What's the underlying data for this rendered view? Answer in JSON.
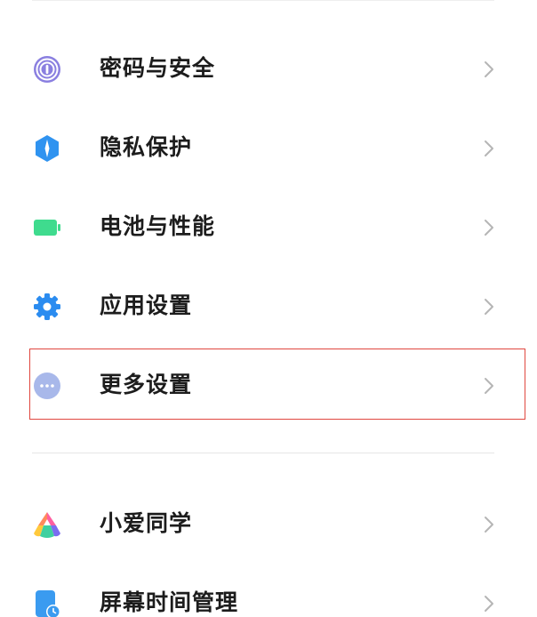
{
  "settings": {
    "items": [
      {
        "label": "密码与安全",
        "icon": "fingerprint-icon",
        "color": "#7c6fd9"
      },
      {
        "label": "隐私保护",
        "icon": "privacy-shield-icon",
        "color": "#3a9bf0"
      },
      {
        "label": "电池与性能",
        "icon": "battery-icon",
        "color": "#3fd98c"
      },
      {
        "label": "应用设置",
        "icon": "gear-icon",
        "color": "#2f8ff0"
      },
      {
        "label": "更多设置",
        "icon": "more-dots-icon",
        "color": "#a9b8e8"
      }
    ],
    "items2": [
      {
        "label": "小爱同学",
        "icon": "xiaoai-icon"
      },
      {
        "label": "屏幕时间管理",
        "icon": "screen-time-icon",
        "color": "#3a9bf0"
      }
    ],
    "highlight_color": "#e0473f"
  }
}
